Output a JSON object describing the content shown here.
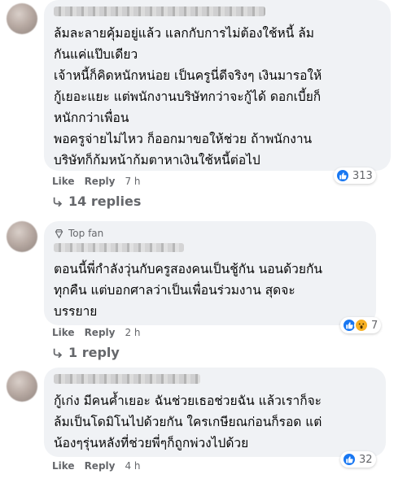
{
  "comments": [
    {
      "lines": "ล้มละลายคุ้มอยู่แล้ว แลกกับการไม่ต้องใช้หนี้ ล้ม\nกันแค่แป๊บเดียว\nเจ้าหนี้ก็คิดหนักหน่อย เป็นครูนี่ดีจริงๆ เงินมารอให้\nกู้เยอะแยะ แต่พนักงานบริษัทกว่าจะกู้ได้ ดอกเบี้ยก็\nหนักกว่าเพื่อน\nพอครูจ่ายไม่ไหว ก็ออกมาขอให้ช่วย ถ้าพนักงาน\nบริษัทก็ก้มหน้าก้มตาหาเงินใช้หนี้ต่อไป",
      "like": "Like",
      "reply": "Reply",
      "time": "7 h",
      "reaction_count": "313",
      "replies": "14 replies"
    },
    {
      "badge": "Top fan",
      "lines": "ตอนนี้พี่กำลังวุ่นกับครูสองคนเป็นชู้กัน นอนด้วยกัน\nทุกคืน แต่บอกศาลว่าเป็นเพื่อนร่วมงาน สุดจะ\nบรรยาย",
      "like": "Like",
      "reply": "Reply",
      "time": "2 h",
      "reaction_count": "7",
      "replies": "1 reply"
    },
    {
      "lines": "กู้เก่ง มีคนค้ำเยอะ ฉันช่วยเธอช่วยฉัน แล้วเราก็จะ\nล้มเป็นโดมิโนไปด้วยกัน ใครเกษียณก่อนก็รอด แต่\nน้องๆรุ่นหลังที่ช่วยพี่ๆก็ถูกพ่วงไปด้วย",
      "like": "Like",
      "reply": "Reply",
      "time": "4 h",
      "reaction_count": "32"
    }
  ],
  "colors": {
    "bubble": "#f0f2f5",
    "meta": "#65676b",
    "like_blue": "#1877f2"
  }
}
